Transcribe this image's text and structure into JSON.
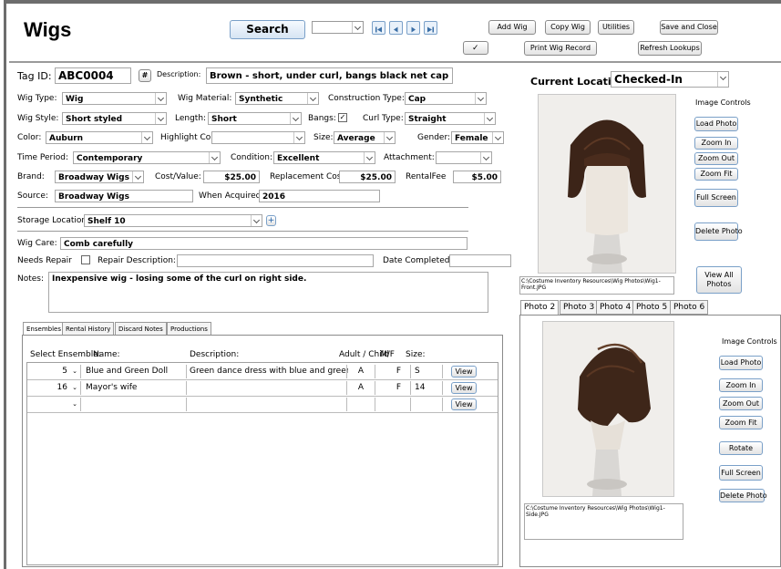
{
  "header": {
    "title": "Wigs",
    "search_label": "Search",
    "add_label": "Add Wig",
    "copy_label": "Copy Wig",
    "utilities_label": "Utilities",
    "save_close_label": "Save and Close",
    "print_label": "Print Wig Record",
    "refresh_label": "Refresh Lookups"
  },
  "record": {
    "tag_label": "Tag ID:",
    "tag_value": "ABC0004",
    "hash_label": "#",
    "description_label": "Description:",
    "description_value": "Brown - short, under curl, bangs  black net cap",
    "wig_type_label": "Wig Type:",
    "wig_type_value": "Wig",
    "material_label": "Wig Material:",
    "material_value": "Synthetic",
    "construction_label": "Construction Type:",
    "construction_value": "Cap",
    "style_label": "Wig Style:",
    "style_value": "Short styled",
    "length_label": "Length:",
    "length_value": "Short",
    "bangs_label": "Bangs:",
    "curl_label": "Curl Type:",
    "curl_value": "Straight",
    "color_label": "Color:",
    "color_value": "Auburn",
    "highlight_label": "Highlight Color:",
    "highlight_value": "",
    "size_label": "Size:",
    "size_value": "Average",
    "gender_label": "Gender:",
    "gender_value": "Female",
    "period_label": "Time Period:",
    "period_value": "Contemporary",
    "condition_label": "Condition:",
    "condition_value": "Excellent",
    "attachment_label": "Attachment:",
    "attachment_value": "",
    "brand_label": "Brand:",
    "brand_value": "Broadway Wigs",
    "cost_label": "Cost/Value:",
    "cost_value": "$25.00",
    "replacement_label": "Replacement Cost:",
    "replacement_value": "$25.00",
    "rental_label": "RentalFee",
    "rental_value": "$5.00",
    "source_label": "Source:",
    "source_value": "Broadway Wigs",
    "acquired_label": "When Acquired:",
    "acquired_value": "2016",
    "storage_label": "Storage Location:",
    "storage_value": "Shelf 10",
    "plus_label": "+",
    "care_label": "Wig Care:",
    "care_value": "Comb carefully",
    "needs_repair_label": "Needs Repair",
    "repair_desc_label": "Repair Description:",
    "repair_desc_value": "",
    "date_completed_label": "Date Completed:",
    "date_completed_value": "",
    "notes_label": "Notes:",
    "notes_value": "Inexpensive wig - losing some of the curl on right side."
  },
  "location": {
    "label": "Current Location:",
    "value": "Checked-In"
  },
  "tabs": [
    "Ensembles",
    "Rental History",
    "Discard Notes",
    "Productions"
  ],
  "ensembles": {
    "headers": [
      "Select Ensemble:",
      "Name:",
      "Description:",
      "Adult / Child",
      "M/F",
      "Size:"
    ],
    "rows": [
      {
        "num": "5",
        "name": "Blue and Green Doll",
        "desc": "Green dance dress with blue and green ski",
        "ac": "A",
        "mf": "F",
        "size": "S",
        "view": "View"
      },
      {
        "num": "16",
        "name": "Mayor's wife",
        "desc": "",
        "ac": "A",
        "mf": "F",
        "size": "14",
        "view": "View"
      },
      {
        "num": "",
        "name": "",
        "desc": "",
        "ac": "",
        "mf": "",
        "size": "",
        "view": "View"
      }
    ]
  },
  "photo1": {
    "controls_title": "Image Controls",
    "load": "Load Photo",
    "zoom_in": "Zoom In",
    "zoom_out": "Zoom Out",
    "zoom_fit": "Zoom Fit",
    "full_screen": "Full Screen",
    "delete": "Delete Photo",
    "view_all": "View All Photos",
    "path": "C:\\Costume Inventory Resources\\Wig Photos\\Wig1-Front.JPG"
  },
  "photo_tabs": [
    "Photo 2",
    "Photo 3",
    "Photo 4",
    "Photo 5",
    "Photo 6"
  ],
  "photo2": {
    "controls_title": "Image Controls",
    "load": "Load Photo",
    "zoom_in": "Zoom In",
    "zoom_out": "Zoom Out",
    "zoom_fit": "Zoom Fit",
    "rotate": "Rotate",
    "full_screen": "Full Screen",
    "delete": "Delete Photo",
    "path": "C:\\Costume Inventory Resources\\Wig Photos\\Wig1-Side.JPG"
  }
}
